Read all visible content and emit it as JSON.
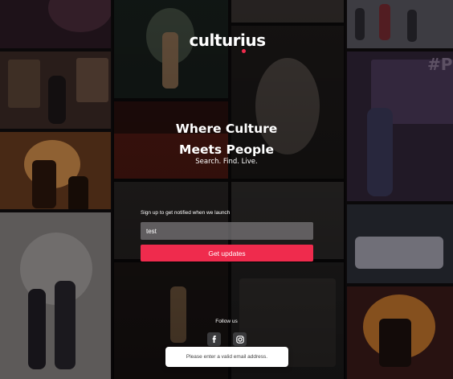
{
  "brand": {
    "name": "culturius",
    "accent": "#ef2b4d"
  },
  "hero": {
    "headline_line1": "Where Culture",
    "headline_line2": "Meets People",
    "tagline": "Search. Find. Live."
  },
  "signup": {
    "label": "Sign up to get notified when we launch",
    "email_value": "test",
    "submit_label": "Get updates"
  },
  "follow": {
    "label": "Follow us",
    "icons": [
      "facebook-icon",
      "instagram-icon"
    ]
  },
  "toast": {
    "message": "Please enter a valid email address."
  },
  "background": {
    "badge_text": "#P"
  }
}
